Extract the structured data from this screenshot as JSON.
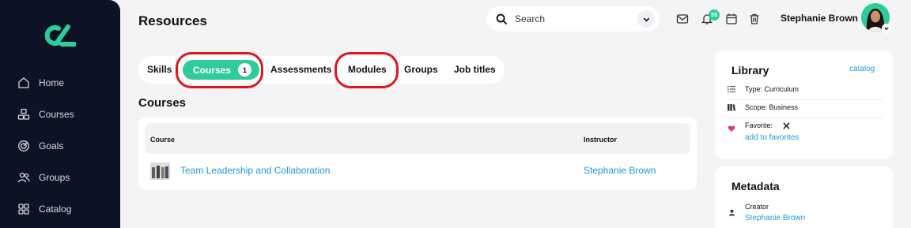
{
  "app": {
    "brand_color": "#2ecc9a",
    "sidebar_color": "#0d1224",
    "highlight_color": "#e2141c"
  },
  "sidebar": {
    "logo": "logo-mark",
    "items": [
      {
        "label": "Home",
        "icon": "home-icon"
      },
      {
        "label": "Courses",
        "icon": "courses-icon"
      },
      {
        "label": "Goals",
        "icon": "goals-icon"
      },
      {
        "label": "Groups",
        "icon": "groups-icon"
      },
      {
        "label": "Catalog",
        "icon": "catalog-icon"
      }
    ]
  },
  "header": {
    "title": "Resources",
    "search": {
      "placeholder": "Search"
    },
    "notification_count": "55",
    "user_name": "Stephanie Brown"
  },
  "tabs": {
    "items": [
      "Skills",
      "Courses",
      "Assessments",
      "Modules",
      "Groups",
      "Job titles"
    ],
    "active": "Courses",
    "active_count": "1",
    "highlighted": [
      "Courses",
      "Modules"
    ]
  },
  "courses": {
    "section_title": "Courses",
    "columns": [
      "Course",
      "Instructor"
    ],
    "rows": [
      {
        "course": "Team Leadership and Collaboration",
        "instructor": "Stephanie Brown"
      }
    ]
  },
  "library": {
    "title": "Library",
    "link": "catalog",
    "type": "Type: Curriculum",
    "scope": "Scope: Business",
    "favorite_label": "Favorite:",
    "favorite_link": "add to favorites"
  },
  "metadata": {
    "title": "Metadata",
    "creator_label": "Creator",
    "creator_name": "Stephanie Brown"
  }
}
